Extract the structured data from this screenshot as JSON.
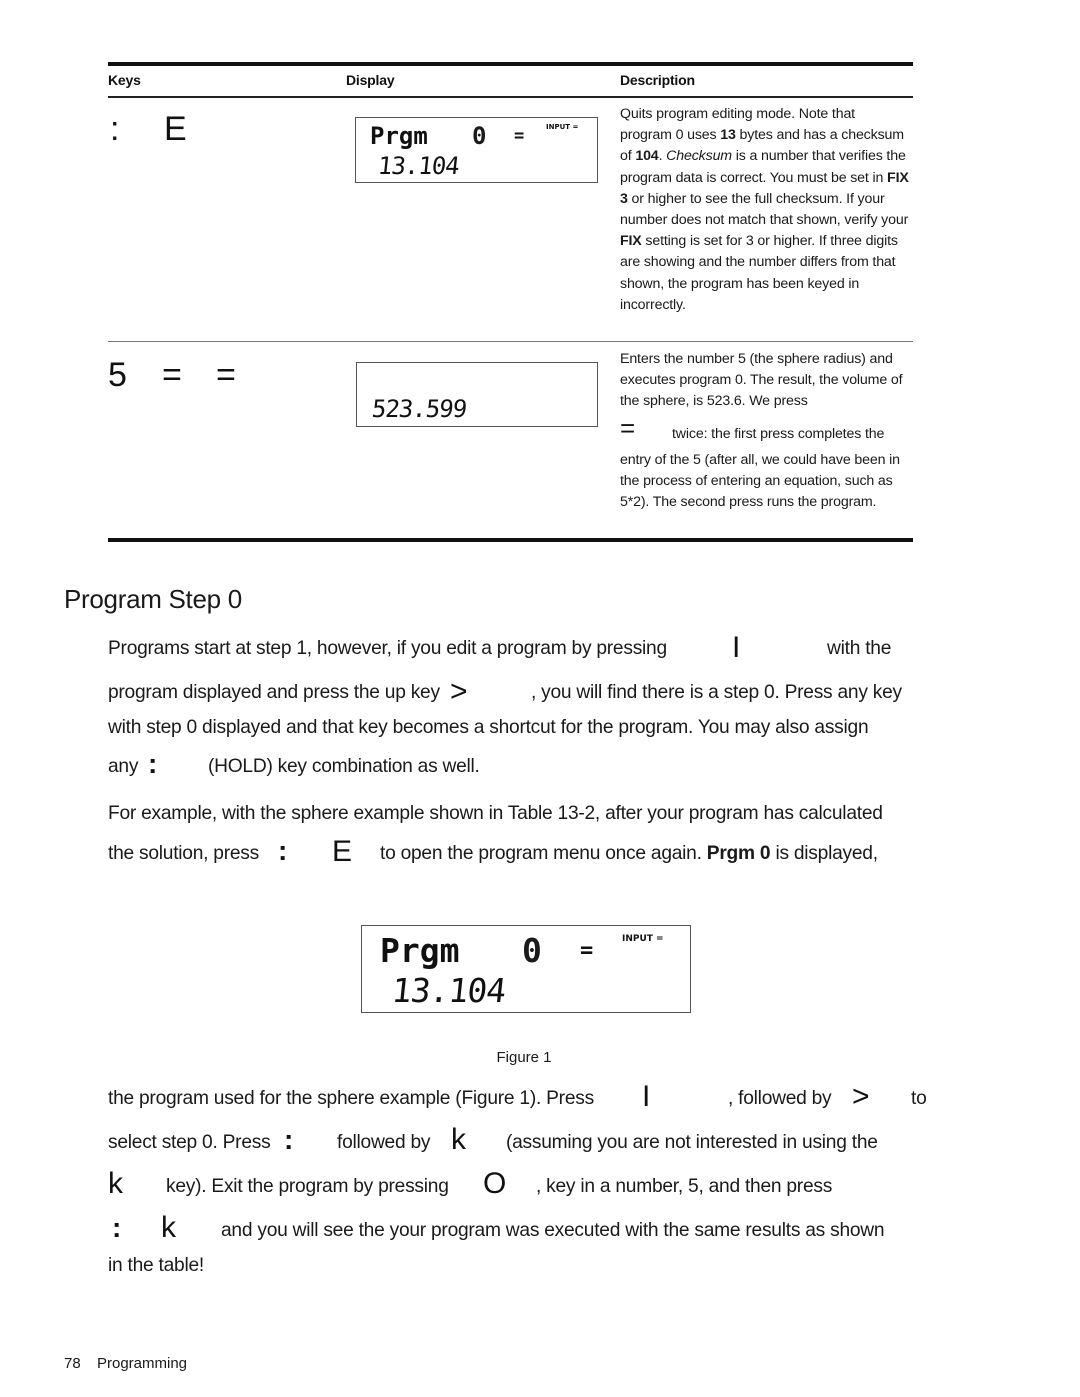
{
  "table": {
    "headers": {
      "keys": "Keys",
      "display": "Display",
      "description": "Description"
    },
    "rows": [
      {
        "keys": [
          ":",
          "E"
        ],
        "display": {
          "line1": "Prgm",
          "program_number": "0",
          "equals": "=",
          "annunciator": "INPUT =",
          "line2": "13.104"
        },
        "description": {
          "p1_a": "Quits program editing mode. Note that program 0 uses ",
          "bytes": "13",
          "p1_b": " bytes and has a checksum of ",
          "checksum": "104",
          "p1_c": ". ",
          "checksum_italic": "Checksum",
          "p1_d": " is a number that verifies the program data is correct. You must be set in ",
          "fix3": "FIX 3",
          "p1_e": " or higher to see the full checksum. If your number does not match that shown, verify your ",
          "fix": "FIX",
          "p1_f": " setting is set for 3 or higher. If three digits are showing and the number differs from that shown, the program has been keyed in incorrectly."
        }
      },
      {
        "keys": [
          "5",
          "=",
          "="
        ],
        "display": {
          "line2": "523.599"
        },
        "description": {
          "p1": "Enters the number 5 (the sphere radius) and executes program 0. The result, the volume of the sphere, is 523.6. We press",
          "key": "=",
          "p2": "twice: the first press completes the",
          "p3": "entry of the 5 (after all, we could have been in the process of entering an equation, such as 5*2). The second press runs the program."
        }
      }
    ]
  },
  "section": {
    "title": "Program Step 0",
    "para1": {
      "l1_a": "Programs start at step 1, however, if you edit a program by pressing",
      "l1_key": "I",
      "l1_b": "with the",
      "l2_a": "program displayed and press the up key",
      "l2_key": ">",
      "l2_b": ", you will find there is a step 0. Press any key",
      "l3": "with step 0 displayed and that key becomes a shortcut for the program. You may also assign",
      "l4_a": "any",
      "l4_key": ":",
      "l4_b": "(HOLD) key combination as well."
    },
    "para2": {
      "l1": "For example, with the sphere example shown in Table 13-2, after your program has calculated",
      "l2_a": "the solution, press",
      "l2_key1": ":",
      "l2_key2": "E",
      "l2_b": "to open the program menu once again.",
      "l2_bold": "Prgm 0",
      "l2_c": "is displayed,"
    },
    "figure": {
      "display": {
        "line1": "Prgm",
        "program_number": "0",
        "equals": "=",
        "annunciator": "INPUT =",
        "line2": "13.104"
      },
      "caption": "Figure 1"
    },
    "para3": {
      "l1_a": "the program used for the sphere example (Figure 1). Press",
      "l1_key1": "I",
      "l1_b": ", followed by",
      "l1_key2": ">",
      "l1_c": "to",
      "l2_a": "select step 0. Press",
      "l2_key1": ":",
      "l2_b": "followed by",
      "l2_key2": "k",
      "l2_c": "(assuming you are not interested in using the",
      "l3_key1": "k",
      "l3_a": "key). Exit the program by pressing",
      "l3_key2": "O",
      "l3_b": ", key in a number, 5, and then press",
      "l4_key1": ":",
      "l4_key2": "k",
      "l4_a": "and you will see the your program was executed with the same results as shown",
      "l5": "in the table!"
    }
  },
  "footer": {
    "page_number": "78",
    "section_name": "Programming"
  }
}
